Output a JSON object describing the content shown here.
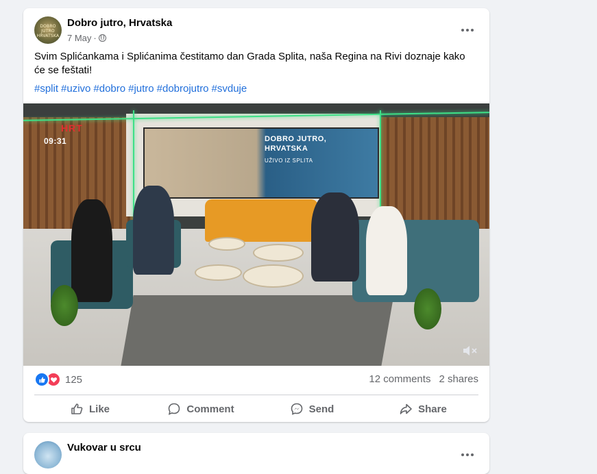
{
  "post1": {
    "page_name": "Dobro jutro, Hrvatska",
    "avatar_text": "DOBRO JUTRO HRVATSKA",
    "date": "7 May",
    "separator": "·",
    "text": "Svim Splićankama i Splićanima čestitamo dan Grada Splita, naša Regina na Rivi doznaje kako će se feštati!",
    "hashtags": [
      "#split",
      "#uzivo",
      "#dobro",
      "#jutro",
      "#dobrojutro",
      "#svduje"
    ],
    "video": {
      "channel_logo": "HRT",
      "clock": "09:31",
      "screen_title_1": "DOBRO JUTRO,",
      "screen_title_2": "HRVATSKA",
      "screen_subtitle": "UŽIVO IZ SPLITA",
      "mute_icon": "volume-muted-icon"
    },
    "reactions": {
      "count": "125",
      "types": [
        "like",
        "love"
      ]
    },
    "comments": "12 comments",
    "shares": "2 shares",
    "actions": {
      "like": "Like",
      "comment": "Comment",
      "send": "Send",
      "share": "Share"
    }
  },
  "post2": {
    "page_name": "Vukovar u srcu"
  },
  "colors": {
    "background": "#f0f2f5",
    "link": "#216fdb",
    "secondary_text": "#65676b",
    "like_blue": "#1877f2",
    "love_red": "#f33e58"
  }
}
